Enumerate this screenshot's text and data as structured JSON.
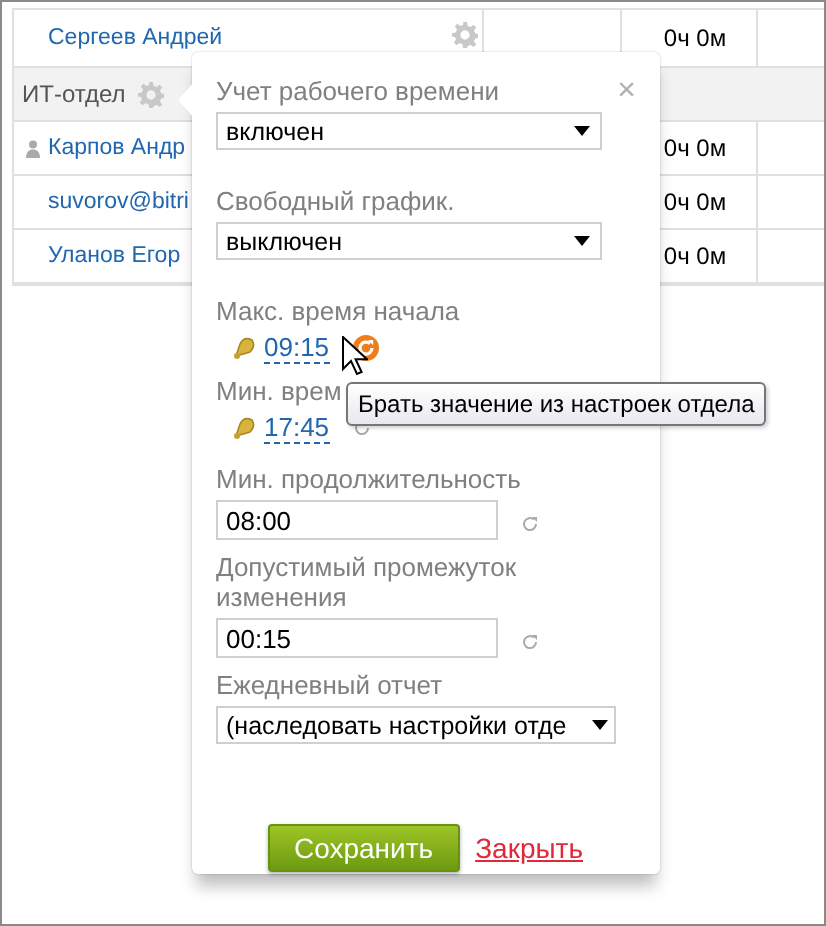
{
  "table": {
    "rows": [
      {
        "kind": "employee",
        "name": "Сергеев Андрей",
        "gear": true,
        "person_icon": false,
        "time": "0ч 0м"
      },
      {
        "kind": "department",
        "name": "ИТ-отдел",
        "gear": true,
        "person_icon": false
      },
      {
        "kind": "employee",
        "name": "Карпов Андр",
        "gear": false,
        "person_icon": true,
        "time": "0ч 0м"
      },
      {
        "kind": "employee",
        "name": "suvorov@bitri",
        "gear": false,
        "person_icon": false,
        "time": "0ч 0м"
      },
      {
        "kind": "employee",
        "name": "Уланов Егор",
        "gear": false,
        "person_icon": false,
        "time": "0ч 0м"
      }
    ]
  },
  "popup": {
    "close": "×",
    "fields": [
      {
        "kind": "select",
        "label": "Учет рабочего времени",
        "value": "включен"
      },
      {
        "kind": "select",
        "label": "Свободный график.",
        "value": "выключен"
      },
      {
        "kind": "time",
        "label": "Макс. время начала",
        "value": "09:15",
        "hovered": true
      },
      {
        "kind": "time",
        "label": "Мин. врем",
        "value": "17:45",
        "hovered": false
      },
      {
        "kind": "input",
        "label": "Мин. продолжительность",
        "value": "08:00"
      },
      {
        "kind": "input",
        "label": "Допустимый промежуток изменения",
        "value": "00:15"
      },
      {
        "kind": "select",
        "label": "Ежедневный отчет",
        "value": "(наследовать настройки отде"
      }
    ],
    "save": "Сохранить",
    "cancel": "Закрыть",
    "tooltip": "Брать значение из настроек отдела"
  }
}
